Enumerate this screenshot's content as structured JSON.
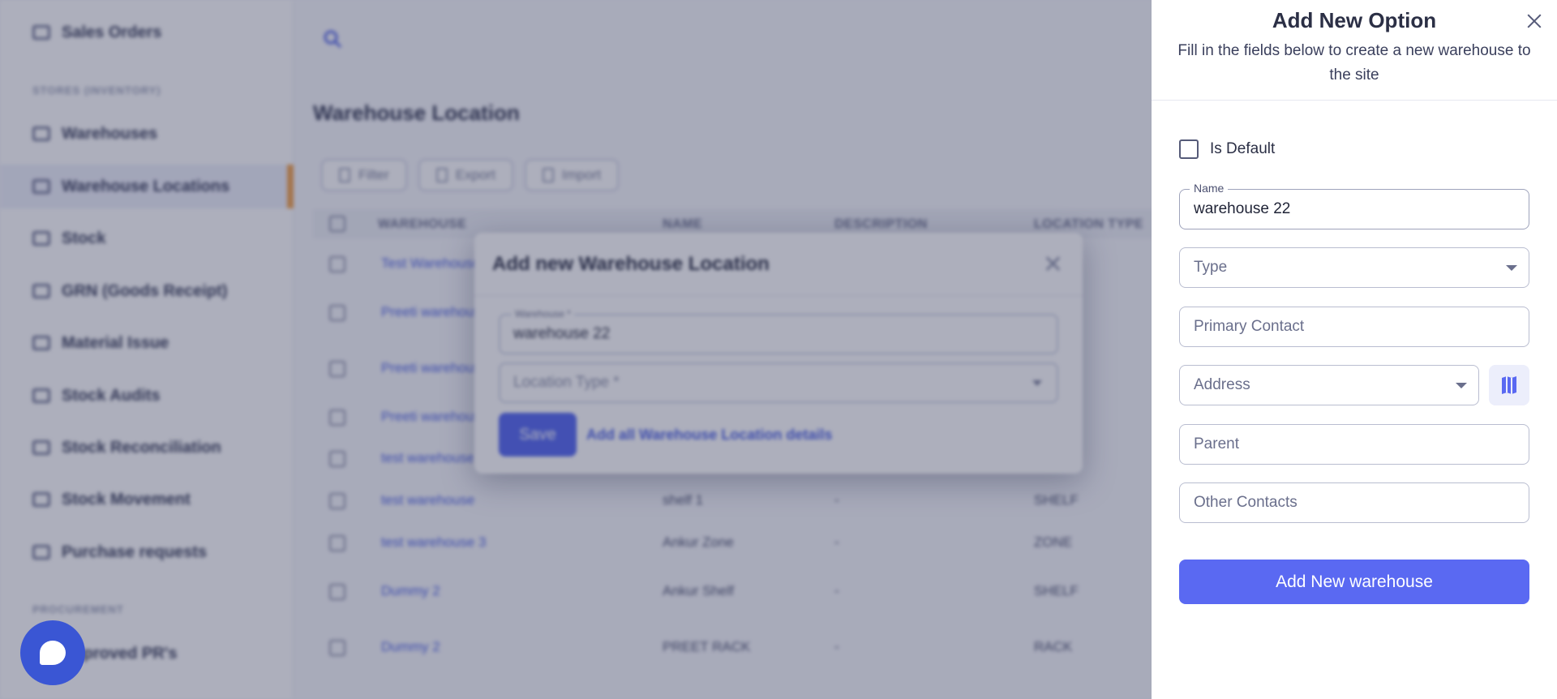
{
  "sidebar": {
    "section_inventory": "STORES (INVENTORY)",
    "section_procurement": "PROCUREMENT",
    "items": [
      {
        "label": "Sales Orders"
      },
      {
        "label": "Warehouses"
      },
      {
        "label": "Warehouse Locations"
      },
      {
        "label": "Stock"
      },
      {
        "label": "GRN (Goods Receipt)"
      },
      {
        "label": "Material Issue"
      },
      {
        "label": "Stock Audits"
      },
      {
        "label": "Stock Reconciliation"
      },
      {
        "label": "Stock Movement"
      },
      {
        "label": "Purchase requests"
      },
      {
        "label": "Approved PR's"
      }
    ]
  },
  "main": {
    "page_title": "Warehouse Location",
    "toolbar": {
      "filter": "Filter",
      "export": "Export",
      "import": "Import"
    },
    "columns": [
      "WAREHOUSE",
      "NAME",
      "DESCRIPTION",
      "LOCATION TYPE"
    ],
    "rows": [
      {
        "warehouse": "Test Warehouse",
        "name": "",
        "description": "",
        "type": ""
      },
      {
        "warehouse": "Preeti warehouse",
        "name": "",
        "description": "",
        "type": ""
      },
      {
        "warehouse": "Preeti warehouse",
        "name": "",
        "description": "",
        "type": ""
      },
      {
        "warehouse": "Preeti warehouse",
        "name": "",
        "description": "",
        "type": ""
      },
      {
        "warehouse": "test warehouse",
        "name": "",
        "description": "",
        "type": ""
      },
      {
        "warehouse": "test warehouse",
        "name": "shelf 1",
        "description": "-",
        "type": "SHELF"
      },
      {
        "warehouse": "test warehouse 3",
        "name": "Ankur Zone",
        "description": "-",
        "type": "ZONE"
      },
      {
        "warehouse": "Dummy 2",
        "name": "Ankur Shelf",
        "description": "-",
        "type": "SHELF"
      },
      {
        "warehouse": "Dummy 2",
        "name": "PREET RACK",
        "description": "-",
        "type": "RACK"
      }
    ]
  },
  "dialog": {
    "title": "Add new Warehouse Location",
    "warehouse_label": "Warehouse *",
    "warehouse_value": "warehouse 22",
    "location_type_placeholder": "Location Type *",
    "save": "Save",
    "details_link": "Add all Warehouse Location details"
  },
  "drawer": {
    "title": "Add New Option",
    "subtitle": "Fill in the fields below to create a new warehouse to the site",
    "is_default_label": "Is Default",
    "name_label": "Name",
    "name_value": "warehouse 22",
    "type_placeholder": "Type",
    "primary_contact_placeholder": "Primary Contact",
    "address_placeholder": "Address",
    "parent_placeholder": "Parent",
    "other_contacts_placeholder": "Other Contacts",
    "submit_label": "Add New warehouse"
  },
  "colors": {
    "primary": "#5a69f2",
    "accent_active": "#f2a24b",
    "link": "#4e63e6"
  },
  "icons": [
    "search-icon",
    "close-icon",
    "map-icon",
    "chat-icon",
    "filter-icon",
    "export-icon",
    "import-icon"
  ]
}
